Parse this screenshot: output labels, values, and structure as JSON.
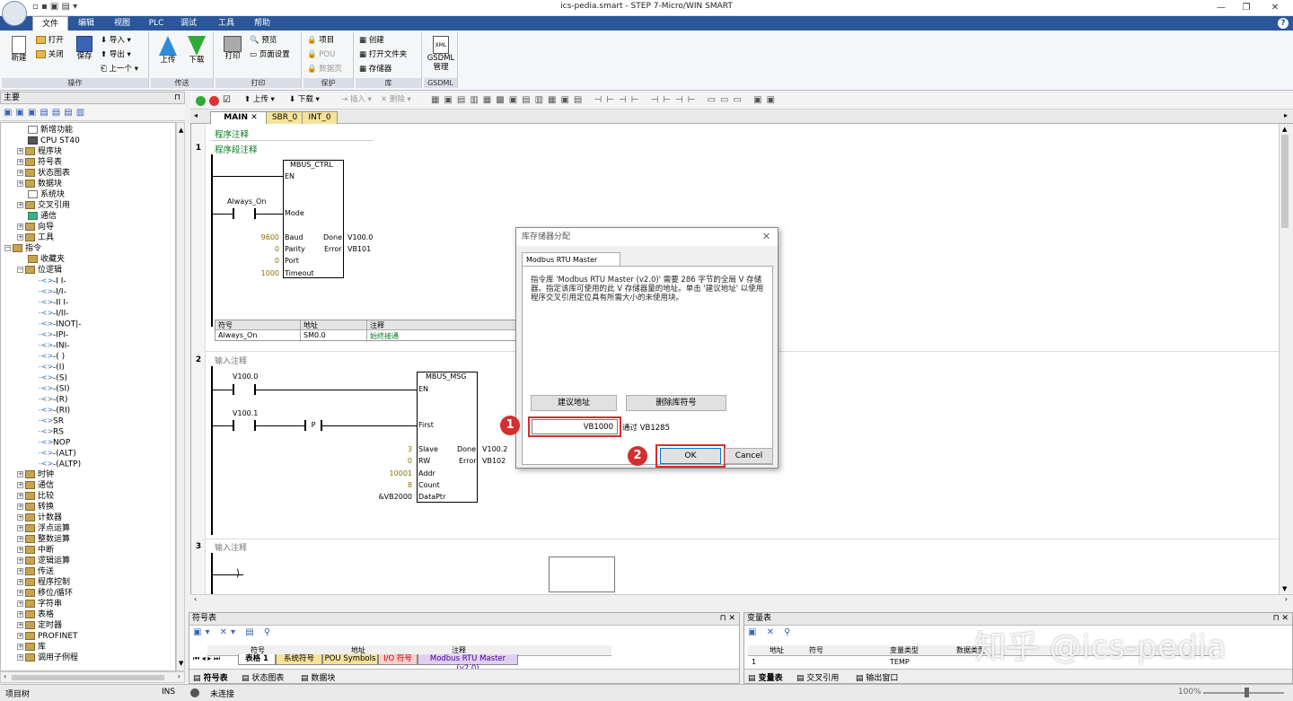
{
  "window": {
    "title": "ics-pedia.smart - STEP 7-Micro/WIN SMART"
  },
  "menu": [
    "文件",
    "编辑",
    "视图",
    "PLC",
    "调试",
    "工具",
    "帮助"
  ],
  "ribbon": {
    "groups": {
      "ops": "操作",
      "transfer": "传送",
      "print": "打印",
      "protect": "保护",
      "lib": "库",
      "gsdml": "GSDML"
    },
    "new": "新建",
    "open": "打开",
    "close": "关闭",
    "save": "保存",
    "import": "导入",
    "export": "导出",
    "up": "上一个",
    "upload": "上传",
    "download": "下载",
    "print": "打印",
    "preview": "预览",
    "page_setup": "页面设置",
    "project": "项目",
    "pou": "POU",
    "datapage": "数据页",
    "create": "创建",
    "open_folder": "打开文件夹",
    "memory": "存储器",
    "gsdml_mgr": "GSDML\n管理",
    "xml": "XML"
  },
  "left_panel": {
    "title": "主要",
    "tree": [
      {
        "label": "新增功能",
        "indent": 1,
        "icon": "doc",
        "exp": false
      },
      {
        "label": "CPU ST40",
        "indent": 1,
        "icon": "cpu",
        "exp": false
      },
      {
        "label": "程序块",
        "indent": 0,
        "icon": "folder",
        "exp": true
      },
      {
        "label": "符号表",
        "indent": 0,
        "icon": "folder",
        "exp": true
      },
      {
        "label": "状态图表",
        "indent": 0,
        "icon": "folder",
        "exp": true
      },
      {
        "label": "数据块",
        "indent": 0,
        "icon": "folder",
        "exp": true
      },
      {
        "label": "系统块",
        "indent": 1,
        "icon": "doc",
        "exp": false
      },
      {
        "label": "交叉引用",
        "indent": 0,
        "icon": "folder",
        "exp": true
      },
      {
        "label": "通信",
        "indent": 1,
        "icon": "pc",
        "exp": false
      },
      {
        "label": "向导",
        "indent": 0,
        "icon": "folder",
        "exp": true
      },
      {
        "label": "工具",
        "indent": 0,
        "icon": "folder",
        "exp": true
      },
      {
        "label": "指令",
        "indent": -1,
        "icon": "folder",
        "exp": true,
        "open": true
      },
      {
        "label": "收藏夹",
        "indent": 1,
        "icon": "folder",
        "exp": false
      },
      {
        "label": "位逻辑",
        "indent": 0,
        "icon": "folder",
        "exp": true,
        "open": true
      },
      {
        "label": "-I I-",
        "indent": 2,
        "icon": "bit",
        "exp": false
      },
      {
        "label": "-I/I-",
        "indent": 2,
        "icon": "bit",
        "exp": false
      },
      {
        "label": "-II I-",
        "indent": 2,
        "icon": "bit",
        "exp": false
      },
      {
        "label": "-I/II-",
        "indent": 2,
        "icon": "bit",
        "exp": false
      },
      {
        "label": "-INOT|-",
        "indent": 2,
        "icon": "bit",
        "exp": false
      },
      {
        "label": "-IPI-",
        "indent": 2,
        "icon": "bit",
        "exp": false
      },
      {
        "label": "-INI-",
        "indent": 2,
        "icon": "bit",
        "exp": false
      },
      {
        "label": "-( )",
        "indent": 2,
        "icon": "bit",
        "exp": false
      },
      {
        "label": "-(I)",
        "indent": 2,
        "icon": "bit",
        "exp": false
      },
      {
        "label": "-(S)",
        "indent": 2,
        "icon": "bit",
        "exp": false
      },
      {
        "label": "-(SI)",
        "indent": 2,
        "icon": "bit",
        "exp": false
      },
      {
        "label": "-(R)",
        "indent": 2,
        "icon": "bit",
        "exp": false
      },
      {
        "label": "-(RI)",
        "indent": 2,
        "icon": "bit",
        "exp": false
      },
      {
        "label": "SR",
        "indent": 2,
        "icon": "bit",
        "exp": false
      },
      {
        "label": "RS",
        "indent": 2,
        "icon": "bit",
        "exp": false
      },
      {
        "label": "NOP",
        "indent": 2,
        "icon": "bit",
        "exp": false
      },
      {
        "label": "-(ALT)",
        "indent": 2,
        "icon": "bit",
        "exp": false
      },
      {
        "label": "-(ALTP)",
        "indent": 2,
        "icon": "bit",
        "exp": false
      },
      {
        "label": "时钟",
        "indent": 0,
        "icon": "folder",
        "exp": true
      },
      {
        "label": "通信",
        "indent": 0,
        "icon": "folder",
        "exp": true
      },
      {
        "label": "比较",
        "indent": 0,
        "icon": "folder",
        "exp": true
      },
      {
        "label": "转换",
        "indent": 0,
        "icon": "folder",
        "exp": true
      },
      {
        "label": "计数器",
        "indent": 0,
        "icon": "folder",
        "exp": true
      },
      {
        "label": "浮点运算",
        "indent": 0,
        "icon": "folder",
        "exp": true
      },
      {
        "label": "整数运算",
        "indent": 0,
        "icon": "folder",
        "exp": true
      },
      {
        "label": "中断",
        "indent": 0,
        "icon": "folder",
        "exp": true
      },
      {
        "label": "逻辑运算",
        "indent": 0,
        "icon": "folder",
        "exp": true
      },
      {
        "label": "传送",
        "indent": 0,
        "icon": "folder",
        "exp": true
      },
      {
        "label": "程序控制",
        "indent": 0,
        "icon": "folder",
        "exp": true
      },
      {
        "label": "移位/循环",
        "indent": 0,
        "icon": "folder",
        "exp": true
      },
      {
        "label": "字符串",
        "indent": 0,
        "icon": "folder",
        "exp": true
      },
      {
        "label": "表格",
        "indent": 0,
        "icon": "folder",
        "exp": true
      },
      {
        "label": "定时器",
        "indent": 0,
        "icon": "folder",
        "exp": true
      },
      {
        "label": "PROFINET",
        "indent": 0,
        "icon": "folder",
        "exp": true
      },
      {
        "label": "库",
        "indent": 0,
        "icon": "folder",
        "exp": true
      },
      {
        "label": "调用子例程",
        "indent": 0,
        "icon": "folder",
        "exp": true
      }
    ]
  },
  "editor": {
    "toolbar": {
      "upload": "上传",
      "download": "下载",
      "insert": "插入",
      "delete": "删除"
    },
    "tabs": [
      "MAIN",
      "SBR_0",
      "INT_0"
    ],
    "program_comment": "程序注释",
    "net1": {
      "no": "1",
      "comment": "程序段注释",
      "block": "MBUS_CTRL",
      "contact": "Always_On",
      "pins_left": [
        "EN",
        "Mode",
        "Baud",
        "Parity",
        "Port",
        "Timeout"
      ],
      "pins_right": [
        "Done",
        "Error"
      ],
      "in_vals": [
        "9600",
        "0",
        "0",
        "1000"
      ],
      "out_vals": [
        "V100.0",
        "VB101"
      ],
      "sym_headers": [
        "符号",
        "地址",
        "注释"
      ],
      "sym_row": [
        "Always_On",
        "SM0.0",
        "始终接通"
      ]
    },
    "net2": {
      "no": "2",
      "comment": "输入注释",
      "block": "MBUS_MSG",
      "c1": "V100.0",
      "c2": "V100.1",
      "p": "P",
      "pins_left": [
        "EN",
        "First",
        "Slave",
        "RW",
        "Addr",
        "Count",
        "DataPtr"
      ],
      "pins_right": [
        "Done",
        "Error"
      ],
      "in_vals": [
        "3",
        "0",
        "10001",
        "8",
        "&VB2000"
      ],
      "out_vals": [
        "V100.2",
        "VB102"
      ]
    },
    "net3": {
      "no": "3",
      "comment": "输入注释"
    }
  },
  "dialog": {
    "title": "库存储器分配",
    "tab": "Modbus RTU Master (v2.0)",
    "message": "指令库 'Modbus RTU Master (v2.0)' 需要 286 字节的全局 V 存储器。指定该库可使用的此 V 存储器量的地址。单击 '建议地址' 以使用程序交叉引用定位具有所需大小的未使用块。",
    "suggest_btn": "建议地址",
    "delete_btn": "删除库符号",
    "address_value": "VB1000",
    "range_text": "通过 VB1285",
    "ok": "OK",
    "cancel": "Cancel",
    "badge1": "1",
    "badge2": "2"
  },
  "symbol_pane": {
    "title": "符号表",
    "headers": [
      "符号",
      "地址",
      "注释"
    ],
    "tabs": [
      "表格 1",
      "系统符号",
      "POU Symbols",
      "I/O 符号",
      "Modbus RTU Master (v2.0)"
    ],
    "bottom_tabs": [
      "符号表",
      "状态图表",
      "数据块"
    ]
  },
  "var_pane": {
    "title": "变量表",
    "headers": [
      "地址",
      "符号",
      "变量类型",
      "数据类型"
    ],
    "row": [
      "1",
      "",
      "TEMP",
      ""
    ],
    "bottom_tabs": [
      "变量表",
      "交叉引用",
      "输出窗口"
    ]
  },
  "status": {
    "left": "项目树",
    "mode": "INS",
    "conn": "未连接",
    "zoom": "100%"
  },
  "watermark": "知乎 @ics-pedia"
}
